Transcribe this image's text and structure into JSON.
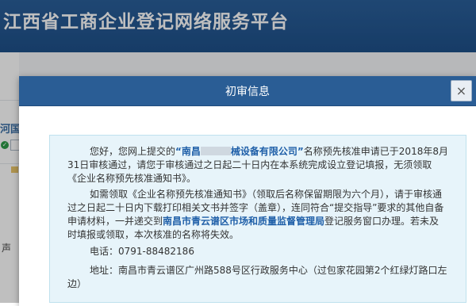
{
  "site": {
    "title": "江西省工商企业登记网络服务平台",
    "side_heading": "河国",
    "side_char": "声"
  },
  "modal": {
    "title": "初审信息",
    "close_label": "×",
    "notice": {
      "p1_prefix": "您好，您网上提交的",
      "company_start": "“南昌",
      "company_end": "械设备有限公司”",
      "p1_suffix": "名称预先核准申请已于2018年8月31日审核通过，请您于审核通过之日起二十日内在本系统完成设立登记填报，无须领取《企业名称预先核准通知书》。",
      "p2_prefix": "如需领取《企业名称预先核准通知书》（领取后名称保留期限为六个月），请于审核通过之日起二十日内下载打印相关文书并签字（盖章），连同符合“提交指导”要求的其他自备申请材料，一并递交到",
      "agency": "南昌市青云谱区市场和质量监督管理局",
      "p2_suffix": "登记服务窗口办理。若未及时填报或领取，本次核准的名称将失效。",
      "phone": "电话：0791-88482186",
      "address": "地址：南昌市青云谱区广州路588号区行政服务中心（过包家花园第2个红绿灯路口左边）"
    }
  },
  "colors": {
    "header_bg": "#1e5089",
    "modal_header_bg": "#2a5d95",
    "notice_bg": "#e7f4fa",
    "highlight": "#1f5fa8"
  }
}
